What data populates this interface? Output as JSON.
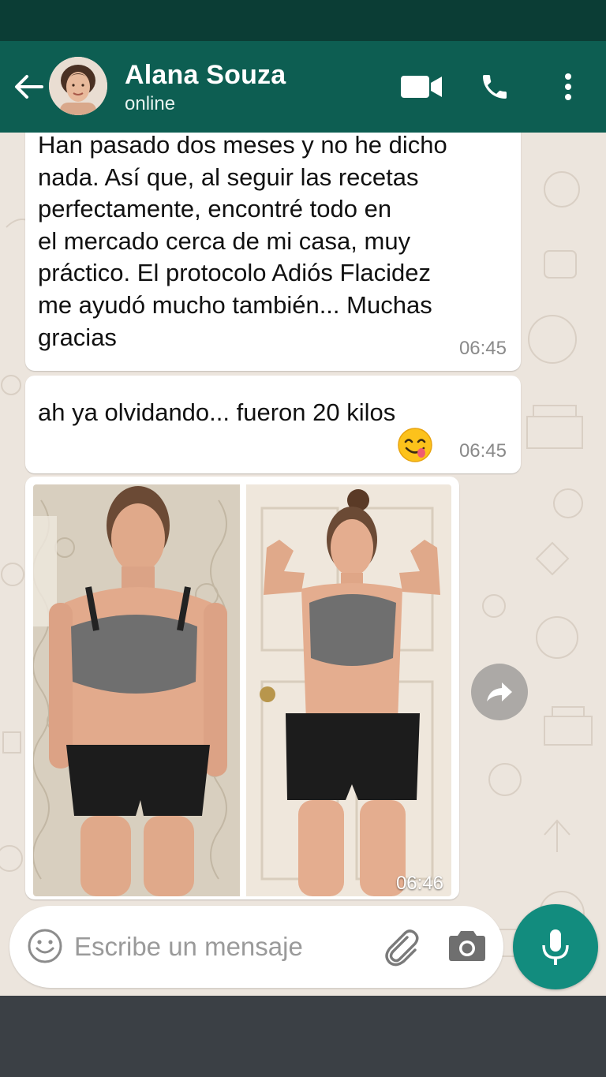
{
  "header": {
    "contact_name": "Alana Souza",
    "contact_status": "online",
    "icons": [
      "back-arrow-icon",
      "avatar",
      "video-call-icon",
      "phone-icon",
      "more-vert-icon"
    ],
    "background_color": "#0d5e52"
  },
  "messages": [
    {
      "type": "text",
      "text": "Han pasado dos meses y no he dicho\nnada. Así que, al seguir las recetas\nperfectamente, encontré todo en\nel mercado cerca de mi casa, muy\npráctico. El protocolo Adiós Flacidez\nme ayudó mucho también... Muchas\ngracias",
      "time": "06:45"
    },
    {
      "type": "text",
      "text": "ah ya olvidando... fueron 20 kilos",
      "emoji": "face-savoring-food-emoji",
      "time": "06:45"
    },
    {
      "type": "image",
      "description_icon": "before-after-photo",
      "time": "06:46"
    }
  ],
  "composer": {
    "placeholder": "Escribe un mensaje",
    "icons": [
      "emoji-icon",
      "attach-icon",
      "camera-icon",
      "mic-icon"
    ],
    "mic_color": "#128c7e"
  },
  "colors": {
    "chat_background": "#ece5dd",
    "bubble": "#ffffff",
    "status_bar": "#0b3d35"
  }
}
